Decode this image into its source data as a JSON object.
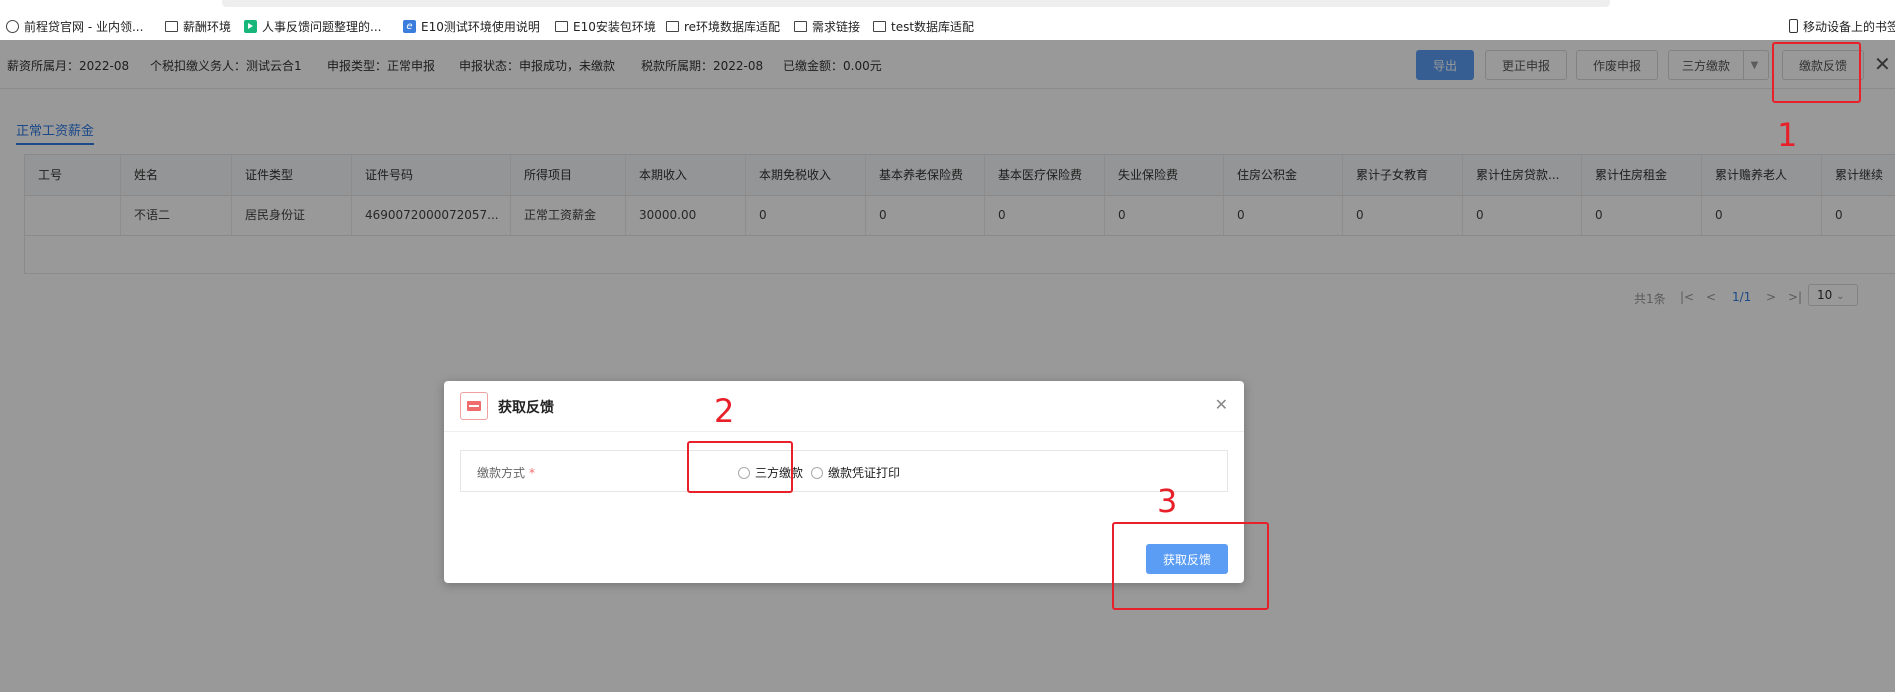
{
  "bookmarks": [
    {
      "label": "前程贷官网 - 业内领...",
      "icon": "globe-icon"
    },
    {
      "label": "薪酬环境",
      "icon": "folder-icon"
    },
    {
      "label": "人事反馈问题整理的...",
      "icon": "green-play-icon"
    },
    {
      "label": "E10测试环境使用说明",
      "icon": "ie-icon"
    },
    {
      "label": "E10安装包环境",
      "icon": "folder-icon"
    },
    {
      "label": "re环境数据库适配",
      "icon": "folder-icon"
    },
    {
      "label": "需求链接",
      "icon": "folder-icon"
    },
    {
      "label": "test数据库适配",
      "icon": "folder-icon"
    }
  ],
  "mobile_bookmarks": "移动设备上的书签",
  "info": {
    "salary_month": "薪资所属月：2022-08",
    "withholder": "个税扣缴义务人：测试云合1",
    "report_type": "申报类型：正常申报",
    "report_status": "申报状态：申报成功，未缴款",
    "tax_period": "税款所属期：2022-08",
    "paid_amount": "已缴金额：0.00元"
  },
  "toolbar": {
    "export": "导出",
    "correct": "更正申报",
    "void": "作废申报",
    "third_party": "三方缴款",
    "feedback": "缴款反馈"
  },
  "tab": "正常工资薪金",
  "table": {
    "headers": [
      "工号",
      "姓名",
      "证件类型",
      "证件号码",
      "所得项目",
      "本期收入",
      "本期免税收入",
      "基本养老保险费",
      "基本医疗保险费",
      "失业保险费",
      "住房公积金",
      "累计子女教育",
      "累计住房贷款...",
      "累计住房租金",
      "累计赡养老人",
      "累计继续"
    ],
    "rows": [
      [
        "",
        "不语二",
        "居民身份证",
        "4690072000072057...",
        "正常工资薪金",
        "30000.00",
        "0",
        "0",
        "0",
        "0",
        "0",
        "0",
        "0",
        "0",
        "0",
        "0"
      ]
    ]
  },
  "pagination": {
    "total": "共1条",
    "page": "1/1",
    "page_size": "10"
  },
  "modal": {
    "title": "获取反馈",
    "field_label": "缴款方式",
    "required_mark": "*",
    "options": [
      "三方缴款",
      "缴款凭证打印"
    ],
    "submit": "获取反馈"
  },
  "annotations": {
    "n1": "1",
    "n2": "2",
    "n3": "3",
    "color": "#e8202a"
  }
}
